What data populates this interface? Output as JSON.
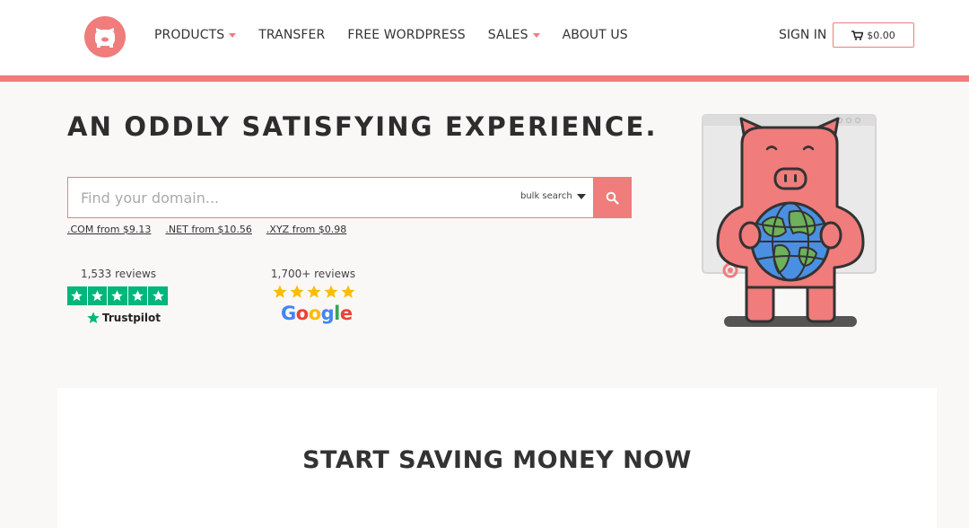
{
  "nav": {
    "items": [
      {
        "label": "PRODUCTS",
        "dropdown": true
      },
      {
        "label": "TRANSFER",
        "dropdown": false
      },
      {
        "label": "FREE WORDPRESS",
        "dropdown": false
      },
      {
        "label": "SALES",
        "dropdown": true
      },
      {
        "label": "ABOUT US",
        "dropdown": false
      }
    ],
    "sign_in": "SIGN IN",
    "cart_total": "$0.00"
  },
  "hero": {
    "title": "AN ODDLY SATISFYING EXPERIENCE.",
    "search_placeholder": "Find your domain...",
    "bulk_search": "bulk search",
    "tlds": [
      ".COM from $9.13",
      ".NET from $10.56",
      ".XYZ from $0.98"
    ]
  },
  "reviews": {
    "trustpilot": {
      "count": "1,533 reviews",
      "brand": "Trustpilot",
      "stars": 5
    },
    "google": {
      "count": "1,700+ reviews",
      "brand": "Google",
      "stars": 5
    }
  },
  "section": {
    "title": "START SAVING MONEY NOW"
  },
  "colors": {
    "accent": "#f07c7c",
    "trustpilot_green": "#00b67a",
    "star_gold": "#fbbc05"
  },
  "icons": [
    "pig-logo-icon",
    "caret-down-icon",
    "cart-icon",
    "search-icon",
    "star-icon",
    "pig-globe-illustration"
  ]
}
